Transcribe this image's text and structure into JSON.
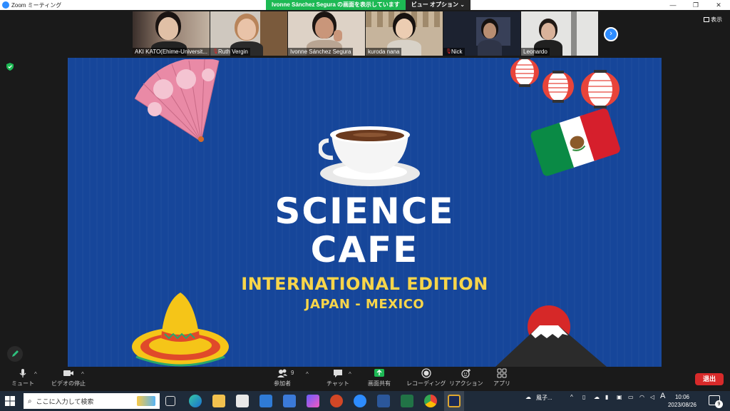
{
  "window": {
    "title": "Zoom ミーティング",
    "share_banner_text": "Ivonne Sánchez Segura の画面を表示しています",
    "view_options_label": "ビュー オプション",
    "view_label": "表示"
  },
  "participants": [
    {
      "name": "AKI KATO(Ehime-Universit...",
      "muted": false
    },
    {
      "name": "Ruth Vergin",
      "muted": true
    },
    {
      "name": "Ivonne Sánchez Segura",
      "muted": false
    },
    {
      "name": "kuroda nana",
      "muted": false
    },
    {
      "name": "Nick",
      "muted": true
    },
    {
      "name": "Leonardo",
      "muted": false
    }
  ],
  "slide": {
    "title_line1": "SCIENCE",
    "title_line2": "CAFE",
    "subtitle": "INTERNATIONAL EDITION",
    "countries": "JAPAN - MEXICO"
  },
  "controls": {
    "mute": "ミュート",
    "stop_video": "ビデオの停止",
    "participants": "参加者",
    "participants_count": "9",
    "chat": "チャット",
    "share_screen": "画面共有",
    "recording": "レコーディング",
    "reactions": "リアクション",
    "apps": "アプリ",
    "leave": "退出"
  },
  "taskbar": {
    "search_placeholder": "ここに入力して検索",
    "weather": "風子...",
    "ime": "A",
    "time": "10:06",
    "date": "2023/08/26",
    "notifications": "9"
  },
  "colors": {
    "zoom_blue": "#2d8cff",
    "share_green": "#1db954",
    "slide_blue": "#16469a",
    "slide_yellow": "#f7d54a",
    "leave_red": "#d82a2a"
  }
}
